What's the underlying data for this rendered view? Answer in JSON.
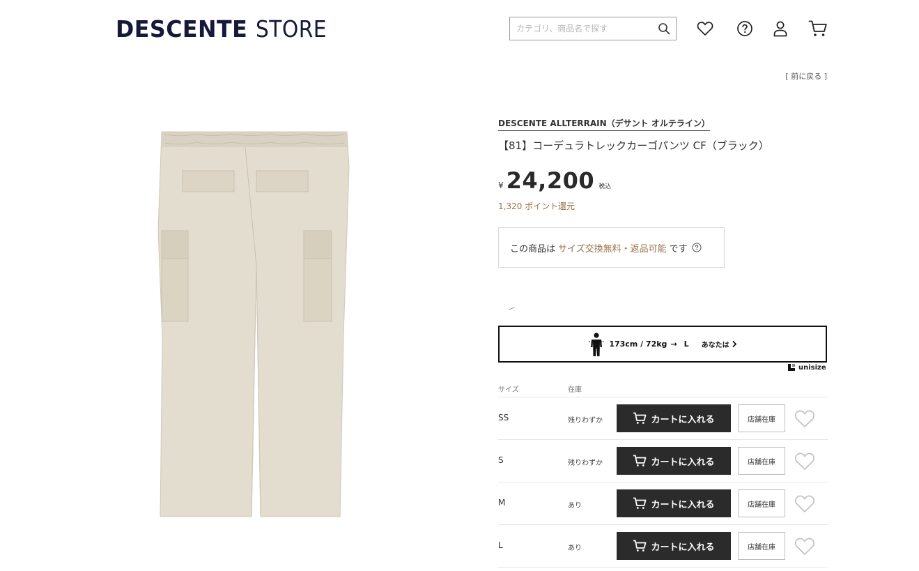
{
  "header": {
    "logo_brand": "DESCENTE",
    "logo_store": "STORE",
    "search_placeholder": "カテゴリ、商品名で探す"
  },
  "nav": {
    "back_link": "[ 前に戻る ]"
  },
  "product": {
    "brand": "DESCENTE ALLTERRAIN（デサント オルテライン）",
    "name": "【81】コーデュラトレックカーゴパンツ CF（ブラック）",
    "currency": "¥",
    "price": "24,200",
    "tax_note": "税込",
    "points": "1,320 ポイント還元",
    "exchange_pre": "この商品は",
    "exchange_highlight": "サイズ交換無料・返品可能",
    "exchange_post": "です"
  },
  "unisize": {
    "measurement": "173cm / 72kg",
    "arrow": "→",
    "recommended_size": "L",
    "you_label": "あなたは",
    "logo_text": "unisize"
  },
  "size_table": {
    "col_size": "サイズ",
    "col_stock": "在庫",
    "cart_label": "カートに入れる",
    "store_stock_label": "店舗在庫",
    "rows": [
      {
        "size": "SS",
        "stock": "残りわずか"
      },
      {
        "size": "S",
        "stock": "残りわずか"
      },
      {
        "size": "M",
        "stock": "あり"
      },
      {
        "size": "L",
        "stock": "あり"
      }
    ]
  },
  "colors": {
    "brand_navy": "#15193a",
    "accent_brown": "#9a7048",
    "button_dark": "#2b2b2b",
    "product_beige": "#e3ddd0"
  },
  "icons": {
    "search": "search-icon",
    "favorite": "heart-icon",
    "help": "help-circle-icon",
    "account": "user-icon",
    "cart": "cart-icon"
  }
}
